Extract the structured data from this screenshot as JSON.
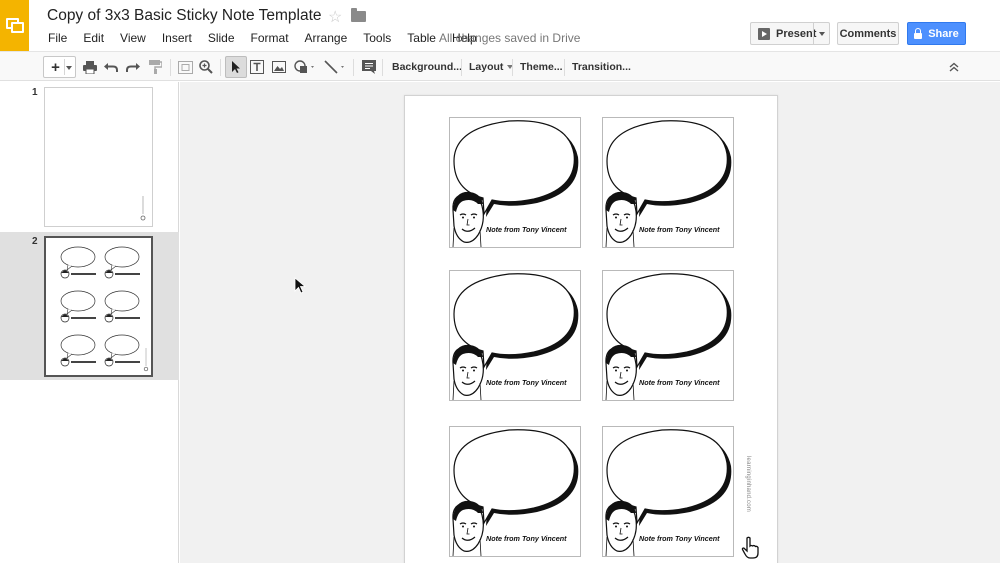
{
  "header": {
    "title": "Copy of 3x3 Basic Sticky Note Template",
    "save_status": "All changes saved in Drive",
    "menu": [
      "File",
      "Edit",
      "View",
      "Insert",
      "Slide",
      "Format",
      "Arrange",
      "Tools",
      "Table",
      "Help"
    ],
    "present_label": "Present",
    "comments_label": "Comments",
    "share_label": "Share",
    "brand_color": "#f4b400",
    "share_color": "#4d90fe"
  },
  "toolbar": {
    "background_label": "Background...",
    "layout_label": "Layout",
    "theme_label": "Theme...",
    "transition_label": "Transition..."
  },
  "filmstrip": {
    "slides": [
      {
        "number": "1"
      },
      {
        "number": "2"
      }
    ]
  },
  "slide": {
    "note_caption": "Note from Tony Vincent",
    "side_credit": "learninginhand.com"
  }
}
